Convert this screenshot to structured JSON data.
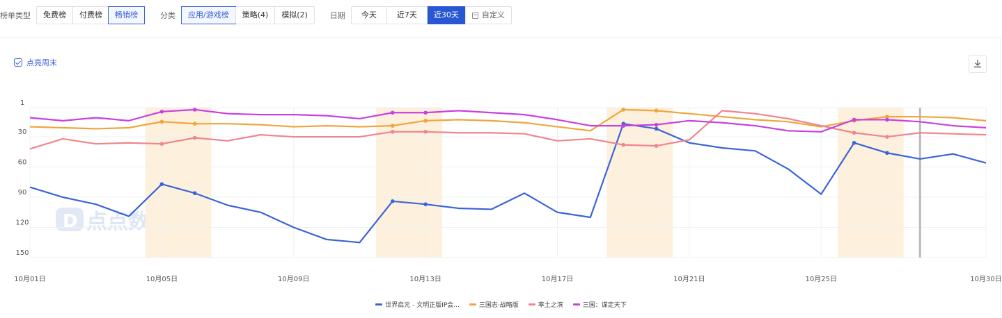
{
  "filters": {
    "rank_type": {
      "label": "榜单类型",
      "options": [
        "免费榜",
        "付费榜",
        "畅销榜"
      ],
      "selected": 2
    },
    "category": {
      "label": "分类",
      "options": [
        "应用/游戏榜",
        "策略(4)",
        "模拟(2)"
      ],
      "selected": 0
    },
    "date": {
      "label": "日期",
      "options": [
        "今天",
        "近7天",
        "近30天"
      ],
      "selected": 2,
      "custom": "自定义"
    }
  },
  "toolbar": {
    "highlight_weekend": "点亮周末"
  },
  "watermark": "点点数据",
  "colors": {
    "accent": "#2857d4",
    "weekend": "#fdf0dc"
  },
  "chart_data": {
    "type": "line",
    "x": [
      "10月01日",
      "10月02日",
      "10月03日",
      "10月04日",
      "10月05日",
      "10月06日",
      "10月07日",
      "10月08日",
      "10月09日",
      "10月10日",
      "10月11日",
      "10月12日",
      "10月13日",
      "10月14日",
      "10月15日",
      "10月16日",
      "10月17日",
      "10月18日",
      "10月19日",
      "10月20日",
      "10月21日",
      "10月22日",
      "10月23日",
      "10月24日",
      "10月25日",
      "10月26日",
      "10月27日",
      "10月28日",
      "10月29日",
      "10月30日"
    ],
    "x_tick_labels": [
      "10月01日",
      "10月05日",
      "10月09日",
      "10月13日",
      "10月17日",
      "10月21日",
      "10月25日",
      "10月30日"
    ],
    "y_tick_labels": [
      "1",
      "30",
      "60",
      "90",
      "120",
      "150"
    ],
    "y_axis": {
      "min": 1,
      "max": 150,
      "inverted": true
    },
    "weekend_highlight": [
      [
        "10月05日",
        "10月06日"
      ],
      [
        "10月12日",
        "10月13日"
      ],
      [
        "10月19日",
        "10月20日"
      ],
      [
        "10月26日",
        "10月27日"
      ]
    ],
    "marker_days": [
      "10月05日",
      "10月06日",
      "10月12日",
      "10月13日",
      "10月19日",
      "10月20日",
      "10月26日",
      "10月27日"
    ],
    "hover_day": "10月28日",
    "series": [
      {
        "name": "世界启元 - 文明正版IP会...",
        "color": "#3a64d8",
        "values": [
          80,
          90,
          97,
          109,
          77,
          86,
          98,
          105,
          120,
          132,
          135,
          94,
          97,
          101,
          102,
          86,
          105,
          110,
          17,
          22,
          36,
          41,
          44,
          62,
          87,
          36,
          46,
          52,
          47,
          56
        ]
      },
      {
        "name": "三国志·战略版",
        "color": "#f0a53a",
        "values": [
          20,
          21,
          22,
          21,
          15,
          17,
          17,
          18,
          20,
          19,
          20,
          19,
          14,
          13,
          14,
          16,
          20,
          24,
          3,
          4,
          7,
          10,
          13,
          15,
          20,
          14,
          10,
          10,
          11,
          14
        ]
      },
      {
        "name": "率土之滨",
        "color": "#f0848c",
        "values": [
          42,
          32,
          37,
          36,
          37,
          31,
          34,
          28,
          30,
          30,
          30,
          25,
          25,
          26,
          26,
          27,
          34,
          32,
          38,
          39,
          33,
          4,
          7,
          12,
          19,
          26,
          30,
          26,
          27,
          28
        ]
      },
      {
        "name": "三国：谋定天下",
        "color": "#c940e0",
        "values": [
          11,
          14,
          11,
          14,
          5,
          3,
          7,
          8,
          8,
          9,
          12,
          6,
          6,
          4,
          6,
          8,
          13,
          19,
          19,
          18,
          14,
          16,
          19,
          24,
          25,
          13,
          13,
          15,
          19,
          21
        ]
      }
    ]
  }
}
